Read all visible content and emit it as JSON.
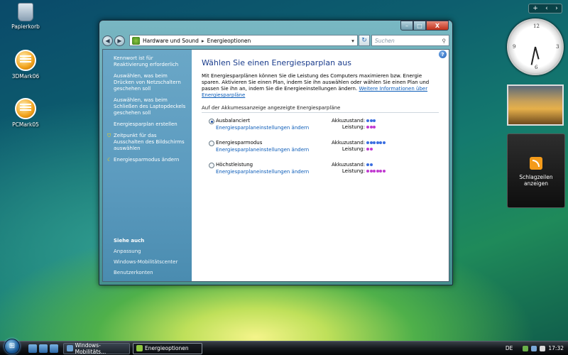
{
  "desktop": {
    "icons": [
      {
        "label": "Papierkorb"
      },
      {
        "label": "3DMark06"
      },
      {
        "label": "PCMark05"
      }
    ]
  },
  "sidebar": {
    "top_controls": [
      "+",
      "‹",
      "›"
    ],
    "clock": {
      "numbers": [
        "12",
        "3",
        "6",
        "9"
      ]
    },
    "feeds_label": "Schlagzeilen anzeigen"
  },
  "window": {
    "buttons": {
      "minimize": "–",
      "maximize": "□",
      "close": "X"
    },
    "breadcrumb": [
      "Hardware und Sound",
      "Energieoptionen"
    ],
    "search_placeholder": "Suchen",
    "left_pane": {
      "links": [
        "Kennwort ist für Reaktivierung erforderlich",
        "Auswählen, was beim Drücken von Netzschaltern geschehen soll",
        "Auswählen, was beim Schließen des Laptopdeckels geschehen soll",
        "Energiesparplan erstellen",
        "Zeitpunkt für das Ausschalten des Bildschirms auswählen",
        "Energiesparmodus ändern"
      ],
      "see_also_heading": "Siehe auch",
      "see_also": [
        "Anpassung",
        "Windows-Mobilitätscenter",
        "Benutzerkonten"
      ]
    },
    "content": {
      "title": "Wählen Sie einen Energiesparplan aus",
      "intro": "Mit Energiesparplänen können Sie die Leistung des Computers maximieren bzw. Energie sparen. Aktivieren Sie einen Plan, indem Sie ihn auswählen oder wählen Sie einen Plan und passen Sie ihn an, indem Sie die Energieeinstellungen ändern.",
      "intro_link": "Weitere Informationen über Energiesparpläne",
      "group_heading": "Auf der Akkumessanzeige angezeigte Energiesparpläne",
      "battery_label": "Akkuzustand:",
      "performance_label": "Leistung:",
      "plans": [
        {
          "name": "Ausbalanciert",
          "link": "Energiesparplaneinstellungen ändern",
          "selected": true,
          "battery": 3,
          "performance": 3
        },
        {
          "name": "Energiesparmodus",
          "link": "Energiesparplaneinstellungen ändern",
          "selected": false,
          "battery": 6,
          "performance": 2
        },
        {
          "name": "Höchstleistung",
          "link": "Energiesparplaneinstellungen ändern",
          "selected": false,
          "battery": 2,
          "performance": 6
        }
      ]
    }
  },
  "taskbar": {
    "tasks": [
      {
        "label": "Windows-Mobilitäts...",
        "active": false
      },
      {
        "label": "Energieoptionen",
        "active": true
      }
    ],
    "language": "DE",
    "time": "17:32"
  },
  "colors": {
    "battery_dot": "#3a6ee0",
    "performance_dot": "#c03ad0",
    "title": "#1a3c8c",
    "link": "#0a5bb8"
  }
}
